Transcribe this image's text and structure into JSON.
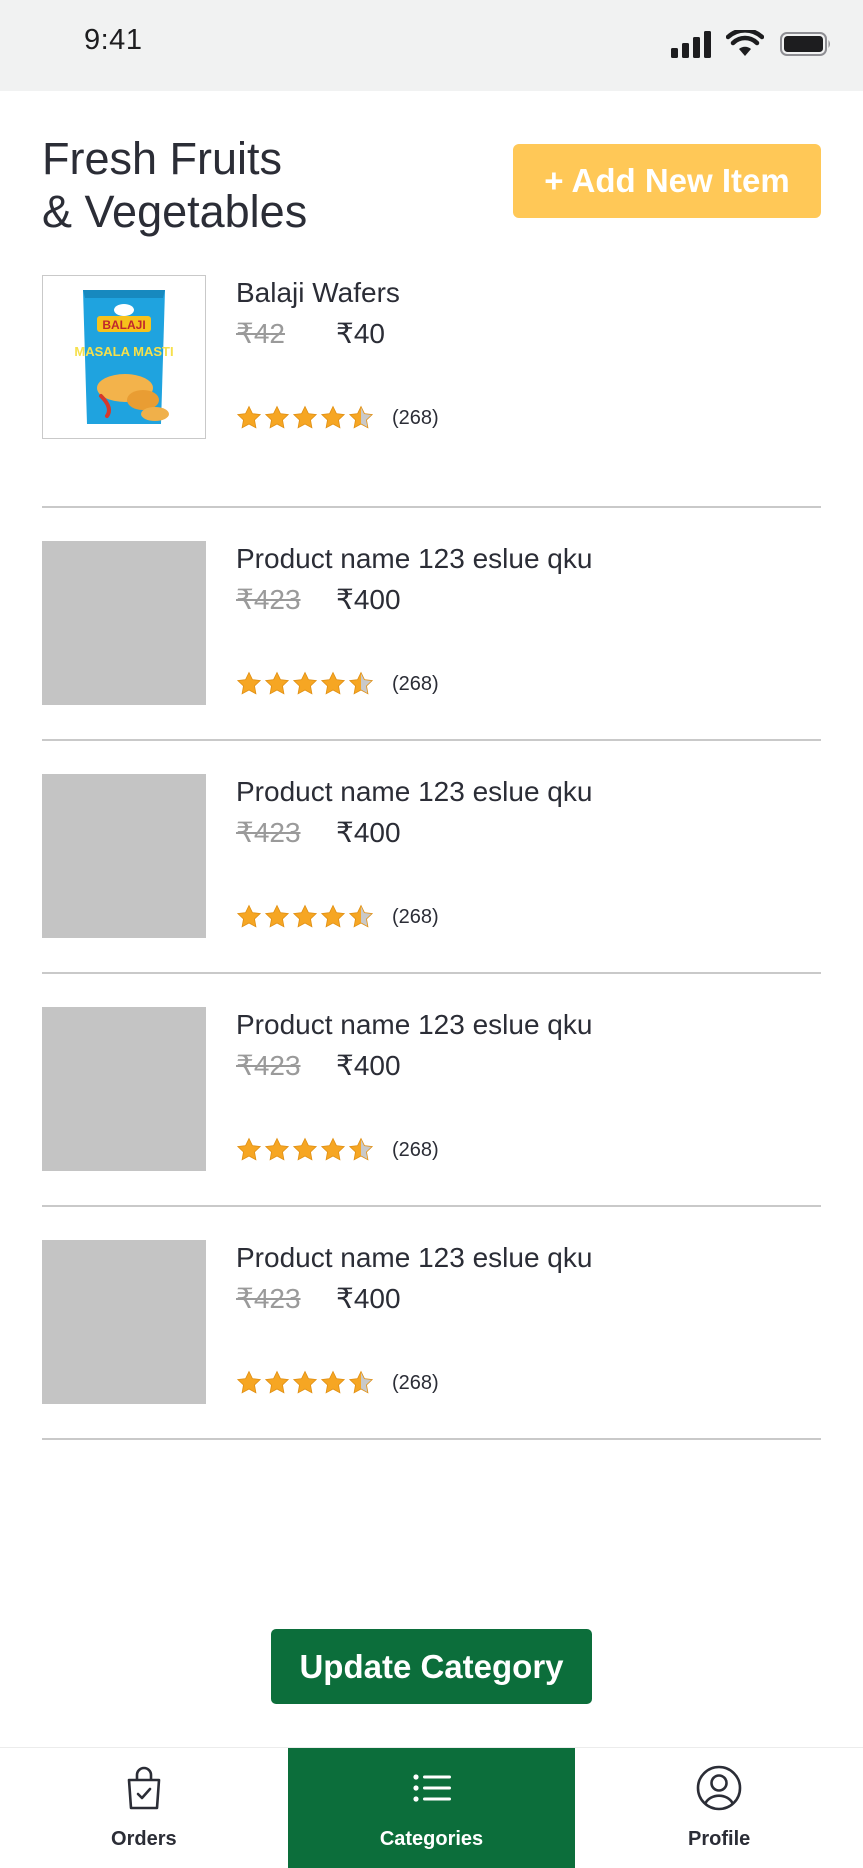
{
  "status_bar": {
    "time": "9:41"
  },
  "header": {
    "title_line1": "Fresh Fruits",
    "title_line2": "& Vegetables",
    "add_button_label": "+ Add New Item"
  },
  "products": [
    {
      "name": "Balaji Wafers",
      "old_price": "₹42",
      "new_price": "₹40",
      "rating": 4.5,
      "reviews": "(268)",
      "has_image": true,
      "image_brand": "BALAJI",
      "image_label": "MASALA MASTI"
    },
    {
      "name": "Product name 123 eslue qku",
      "old_price": "₹423",
      "new_price": "₹400",
      "rating": 4.5,
      "reviews": "(268)",
      "has_image": false
    },
    {
      "name": "Product name 123 eslue qku",
      "old_price": "₹423",
      "new_price": "₹400",
      "rating": 4.5,
      "reviews": "(268)",
      "has_image": false
    },
    {
      "name": "Product name 123 eslue qku",
      "old_price": "₹423",
      "new_price": "₹400",
      "rating": 4.5,
      "reviews": "(268)",
      "has_image": false
    },
    {
      "name": "Product name 123 eslue qku",
      "old_price": "₹423",
      "new_price": "₹400",
      "rating": 4.5,
      "reviews": "(268)",
      "has_image": false
    }
  ],
  "update_button_label": "Update Category",
  "bottom_nav": {
    "items": [
      {
        "label": "Orders",
        "icon": "shopping-bag-check-icon",
        "active": false
      },
      {
        "label": "Categories",
        "icon": "list-icon",
        "active": true
      },
      {
        "label": "Profile",
        "icon": "user-circle-icon",
        "active": false
      }
    ]
  },
  "colors": {
    "accent_yellow": "#ffc857",
    "brand_green": "#0c6e3b",
    "star_orange": "#f6a623",
    "placeholder_gray": "#c4c4c4"
  }
}
